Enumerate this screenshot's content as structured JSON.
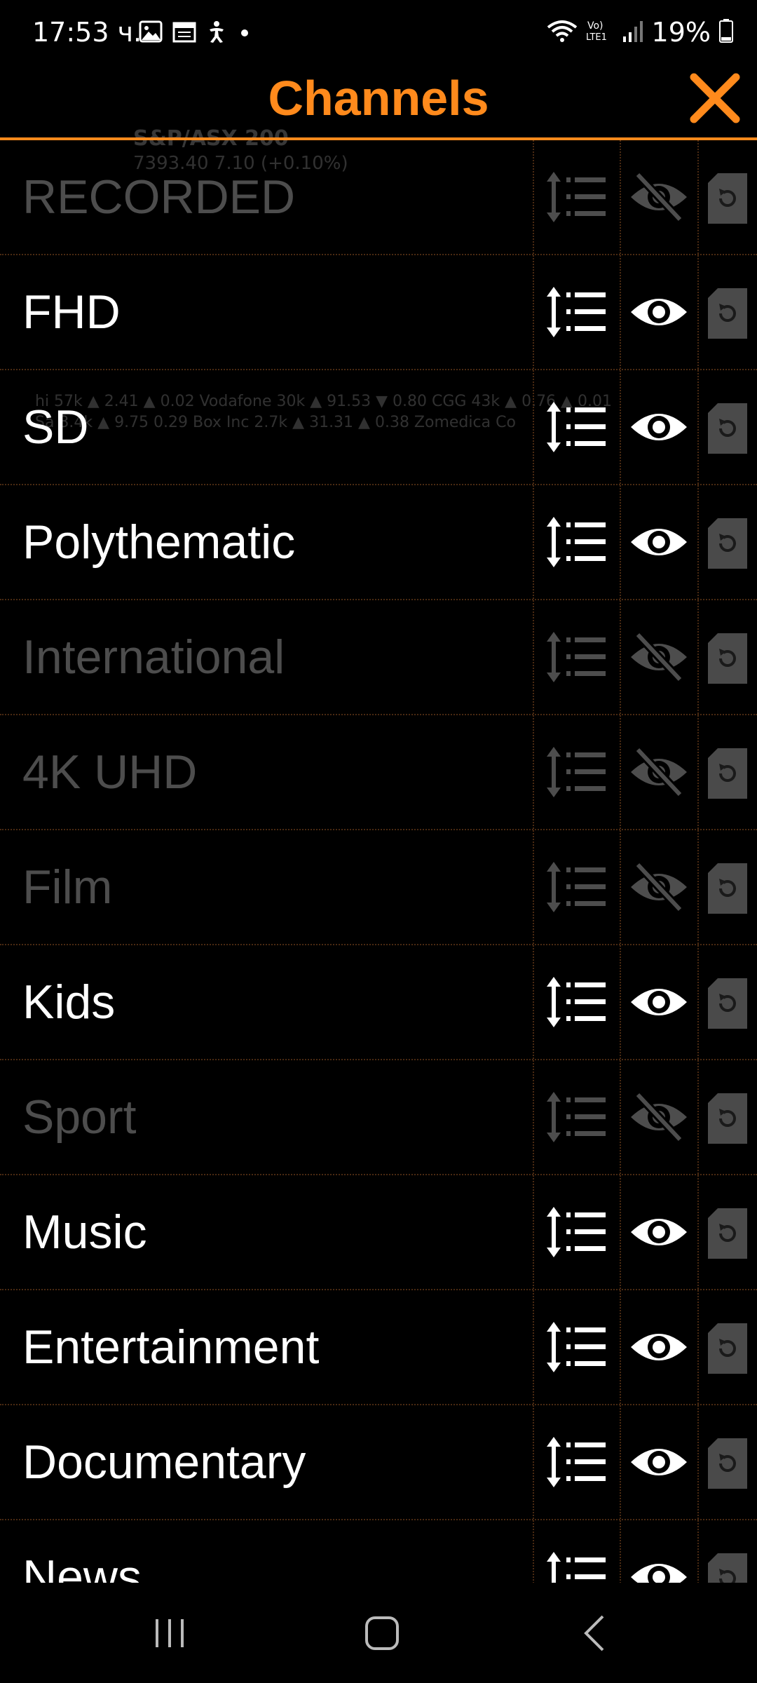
{
  "status_bar": {
    "time": "17:53 ч.",
    "battery_percent": "19%",
    "left_icons": [
      "image-icon",
      "calendar-icon",
      "accessibility-icon"
    ],
    "right_icons": [
      "wifi-icon",
      "volte-icon",
      "signal-icon",
      "battery-icon"
    ]
  },
  "background_app": {
    "title": "S&P/ASX 200",
    "quote": "7393.40   7.10 (+0.10%)",
    "ticker_line1": "hi 57k ▲ 2.41 ▲ 0.02   Vodafone 30k ▲ 91.53 ▼ 0.80   CGG 43k ▲ 0.76 ▲ 0.01",
    "ticker_line2": "Sa 3.4k ▲ 9.75   0.29   Box Inc 2.7k ▲ 31.31 ▲ 0.38   Zomedica Co"
  },
  "header": {
    "title": "Channels",
    "accent_color": "#ff8a1c"
  },
  "channels": [
    {
      "label": "RECORDED",
      "visible": false
    },
    {
      "label": "FHD",
      "visible": true
    },
    {
      "label": "SD",
      "visible": true
    },
    {
      "label": "Polythematic",
      "visible": true
    },
    {
      "label": "International",
      "visible": false
    },
    {
      "label": "4K UHD",
      "visible": false
    },
    {
      "label": "Film",
      "visible": false
    },
    {
      "label": "Kids",
      "visible": true
    },
    {
      "label": "Sport",
      "visible": false
    },
    {
      "label": "Music",
      "visible": true
    },
    {
      "label": "Entertainment",
      "visible": true
    },
    {
      "label": "Documentary",
      "visible": true
    },
    {
      "label": "News",
      "visible": true
    }
  ],
  "nav_bar": {
    "buttons": [
      "recent-apps",
      "home",
      "back"
    ]
  }
}
